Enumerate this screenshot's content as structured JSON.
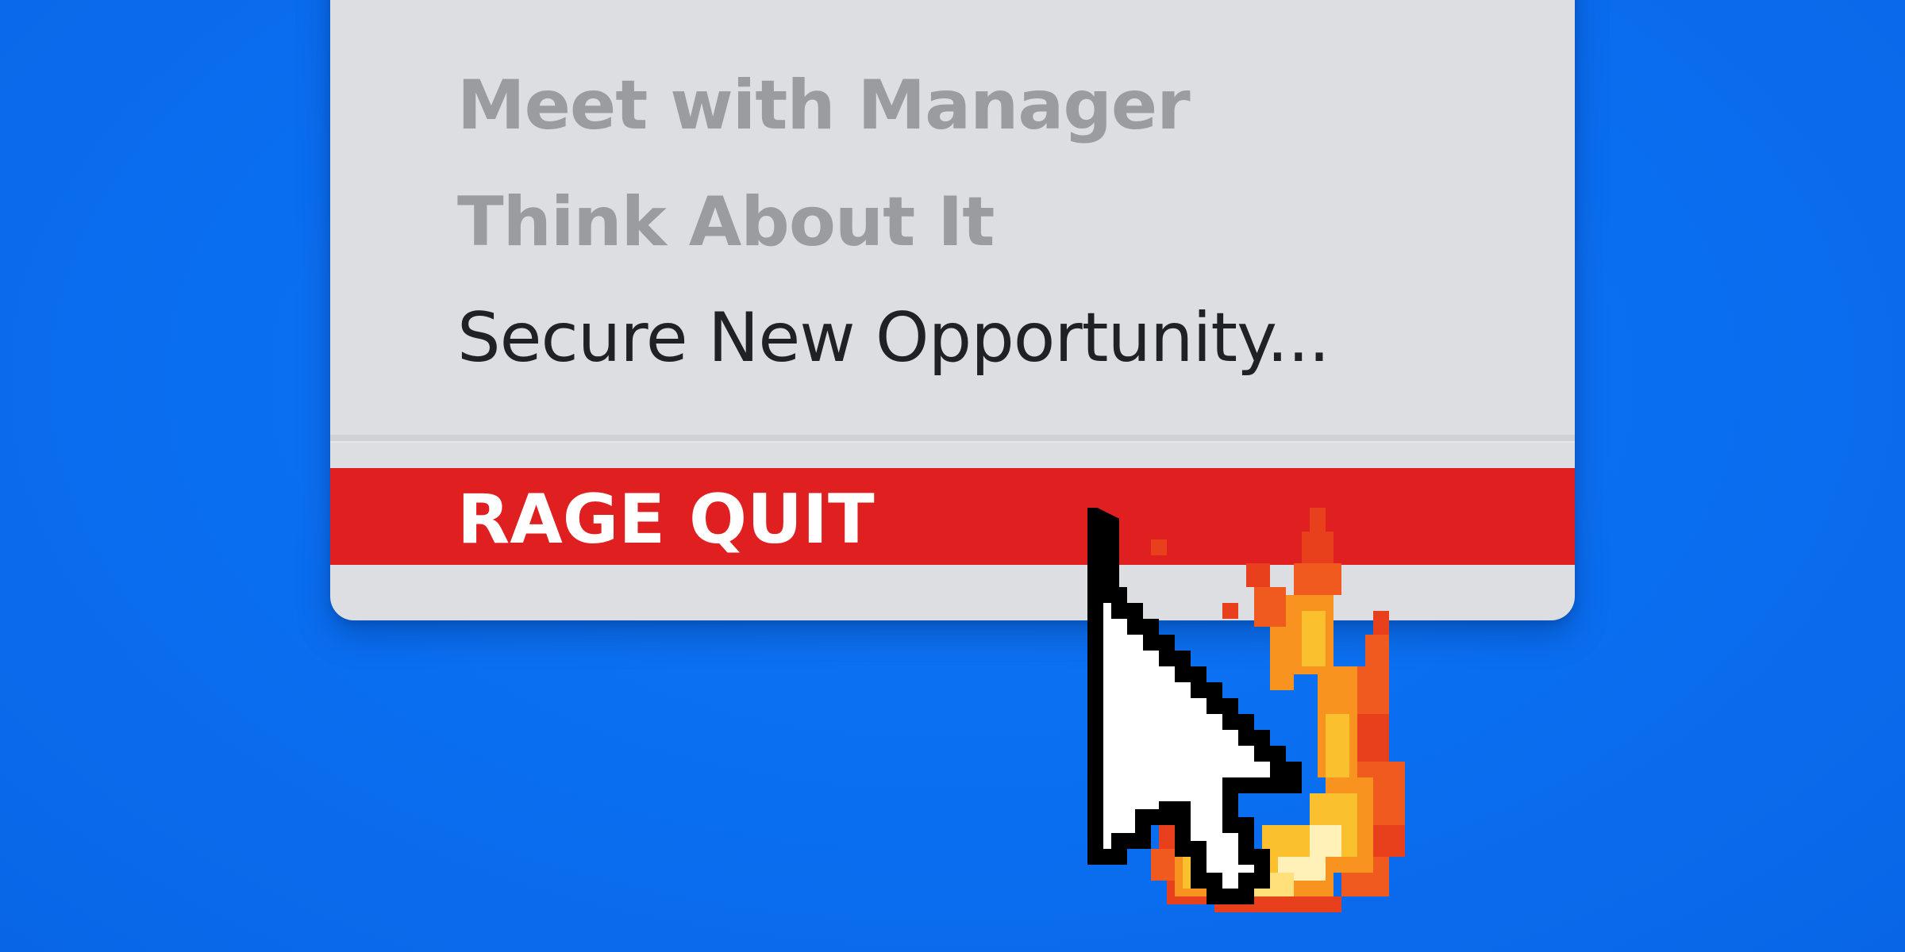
{
  "menu": {
    "items": [
      {
        "label": "Meet with Manager",
        "enabled": false
      },
      {
        "label": "Think About It",
        "enabled": false
      },
      {
        "label": "Secure New Opportunity...",
        "enabled": true
      }
    ],
    "danger_item": {
      "label": "RAGE QUIT",
      "highlighted": true
    }
  },
  "cursor": {
    "icon": "flaming-pointer-cursor-icon"
  },
  "colors": {
    "background": "#0a6ef0",
    "menu": "#dcdee2",
    "highlight": "#e01f20",
    "disabled_text": "#9a9c9f",
    "enabled_text": "#1f2124",
    "highlight_text": "#ffffff"
  }
}
